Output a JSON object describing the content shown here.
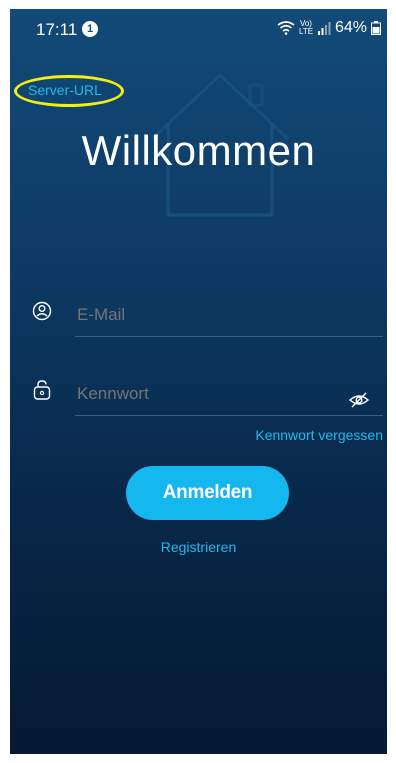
{
  "status_bar": {
    "time": "17:11",
    "notification_count": "1",
    "network_label": "Vo) LTE",
    "battery": "64%"
  },
  "header": {
    "server_url_link": "Server-URL",
    "title": "Willkommen"
  },
  "form": {
    "email_placeholder": "E-Mail",
    "password_placeholder": "Kennwort",
    "forgot_password": "Kennwort vergessen",
    "login_button": "Anmelden",
    "register_link": "Registrieren"
  },
  "colors": {
    "accent": "#14b8ee",
    "link": "#26b7ea",
    "highlight_ring": "#f4ef12",
    "background_top": "#124a78",
    "background_bottom": "#051a33"
  },
  "icons": {
    "email_field": "user-icon",
    "password_field": "lock-icon",
    "password_visibility": "eye-off-icon",
    "background": "house-icon"
  }
}
